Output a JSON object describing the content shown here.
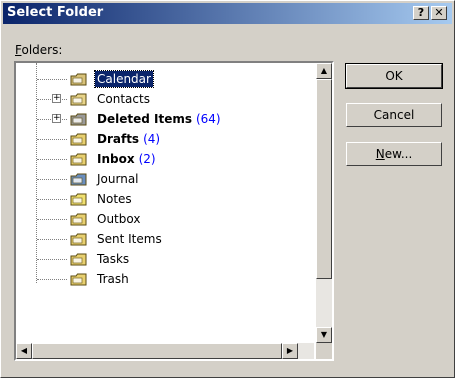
{
  "window": {
    "title": "Select Folder"
  },
  "titlebar": {
    "help_label": "?",
    "close_label": "✕"
  },
  "folders_label": {
    "prefix": "F",
    "rest": "olders:"
  },
  "tree": {
    "items": [
      {
        "label": "Calendar",
        "count": "",
        "bold": false,
        "selected": true,
        "expandable": false,
        "icon": "calendar-icon"
      },
      {
        "label": "Contacts",
        "count": "",
        "bold": false,
        "selected": false,
        "expandable": true,
        "icon": "contacts-icon"
      },
      {
        "label": "Deleted Items",
        "count": "(64)",
        "bold": true,
        "selected": false,
        "expandable": true,
        "icon": "trash-folder-icon"
      },
      {
        "label": "Drafts",
        "count": "(4)",
        "bold": true,
        "selected": false,
        "expandable": false,
        "icon": "drafts-icon"
      },
      {
        "label": "Inbox",
        "count": "(2)",
        "bold": true,
        "selected": false,
        "expandable": false,
        "icon": "inbox-icon"
      },
      {
        "label": "Journal",
        "count": "",
        "bold": false,
        "selected": false,
        "expandable": false,
        "icon": "journal-icon"
      },
      {
        "label": "Notes",
        "count": "",
        "bold": false,
        "selected": false,
        "expandable": false,
        "icon": "notes-icon"
      },
      {
        "label": "Outbox",
        "count": "",
        "bold": false,
        "selected": false,
        "expandable": false,
        "icon": "outbox-icon"
      },
      {
        "label": "Sent Items",
        "count": "",
        "bold": false,
        "selected": false,
        "expandable": false,
        "icon": "sent-items-icon"
      },
      {
        "label": "Tasks",
        "count": "",
        "bold": false,
        "selected": false,
        "expandable": false,
        "icon": "tasks-icon"
      },
      {
        "label": "Trash",
        "count": "",
        "bold": false,
        "selected": false,
        "expandable": false,
        "icon": "folder-icon"
      }
    ]
  },
  "buttons": {
    "ok": "OK",
    "cancel": "Cancel",
    "new_prefix": "N",
    "new_rest": "ew..."
  },
  "colors": {
    "title_start": "#0a246a",
    "title_end": "#a6caf0",
    "selection": "#0a246a",
    "count": "#0000ff"
  }
}
